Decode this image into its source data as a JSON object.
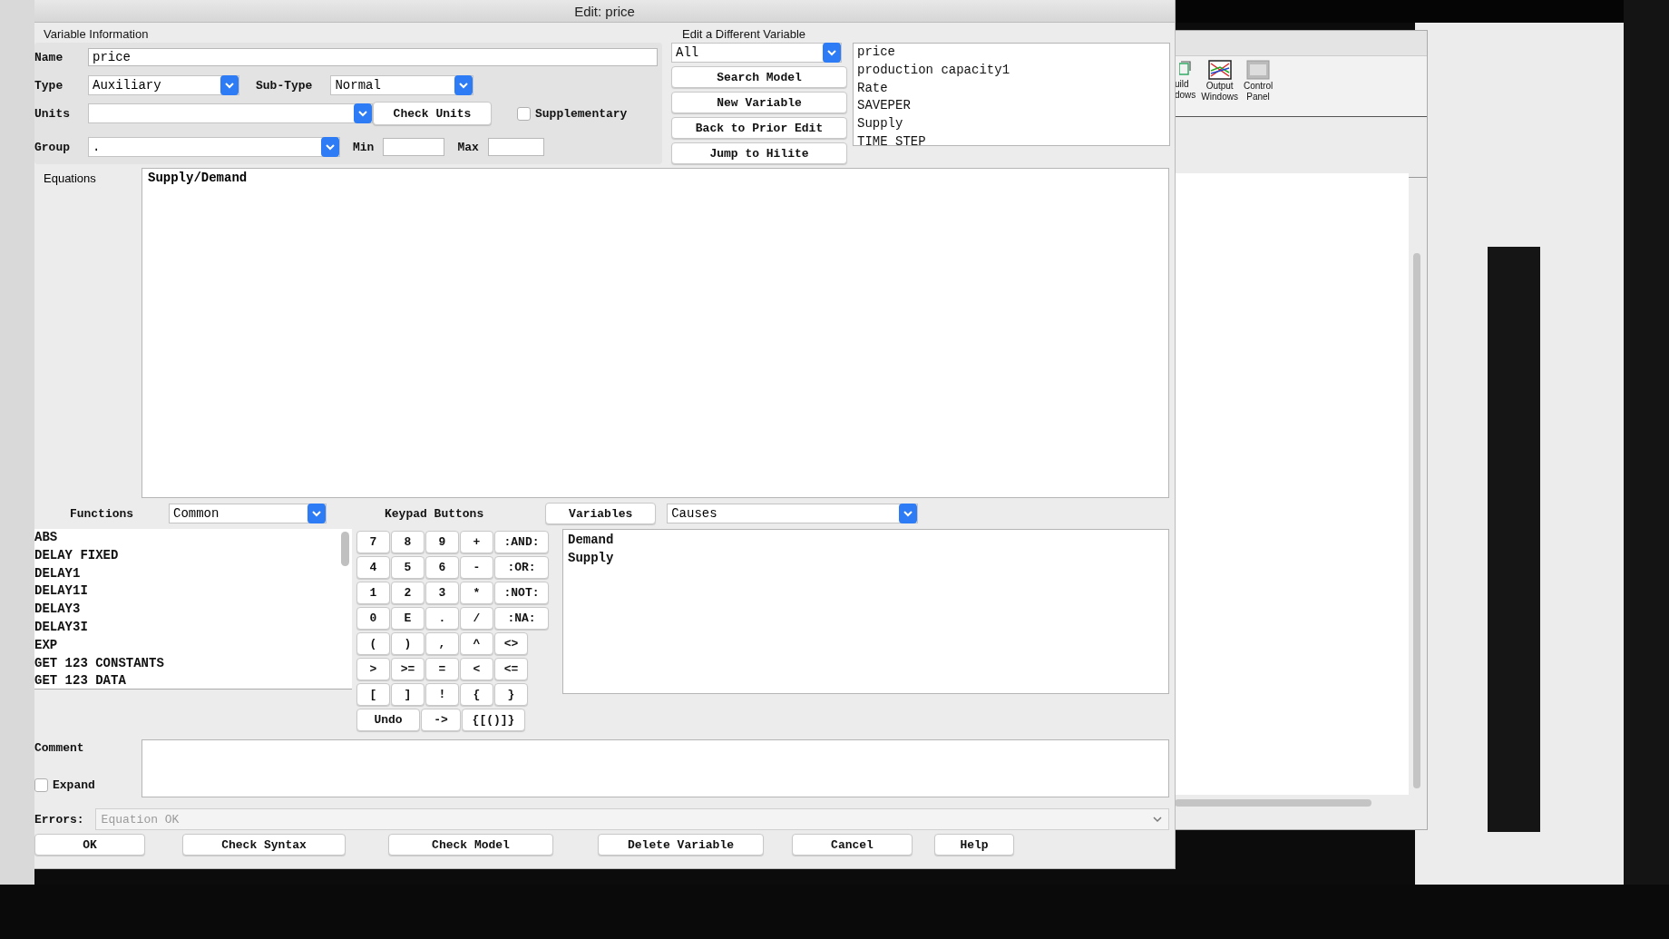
{
  "window": {
    "title": "Edit: price"
  },
  "variable_information": {
    "heading": "Variable Information",
    "name": {
      "label": "Name",
      "value": "price"
    },
    "type": {
      "label": "Type",
      "value": "Auxiliary"
    },
    "sub_type": {
      "label": "Sub-Type",
      "value": "Normal"
    },
    "units": {
      "label": "Units"
    },
    "check_units_button": "Check Units",
    "supplementary": {
      "label": "Supplementary",
      "checked": false
    },
    "group": {
      "label": "Group",
      "value": "."
    },
    "min": {
      "label": "Min"
    },
    "max": {
      "label": "Max"
    }
  },
  "edit_different_variable": {
    "heading": "Edit a Different Variable",
    "filter": "All",
    "buttons": [
      "Search Model",
      "New Variable",
      "Back to Prior Edit",
      "Jump to Hilite"
    ],
    "variables": [
      "price",
      "production capacity1",
      "Rate",
      "SAVEPER",
      "Supply",
      "TIME STEP"
    ]
  },
  "equations": {
    "label": "Equations",
    "value": "Supply/Demand"
  },
  "functions": {
    "label": "Functions",
    "category": "Common",
    "items": [
      "ABS",
      "DELAY FIXED",
      "DELAY1",
      "DELAY1I",
      "DELAY3",
      "DELAY3I",
      "EXP",
      "GET 123 CONSTANTS",
      "GET 123 DATA"
    ]
  },
  "keypad": {
    "label": "Keypad Buttons",
    "rows": [
      [
        "7",
        "8",
        "9",
        "+",
        ":AND:"
      ],
      [
        "4",
        "5",
        "6",
        "-",
        ":OR:"
      ],
      [
        "1",
        "2",
        "3",
        "*",
        ":NOT:"
      ],
      [
        "0",
        "E",
        ".",
        "/",
        ":NA:"
      ],
      [
        "(",
        ")",
        ",",
        "^",
        "<>"
      ],
      [
        ">",
        ">=",
        "=",
        "<",
        "<="
      ],
      [
        "[",
        "]",
        "!",
        "{",
        "}"
      ]
    ],
    "actions": [
      "Undo",
      "->",
      "{[()]}"
    ]
  },
  "variables_panel": {
    "tab": "Variables",
    "mode": "Causes",
    "items": [
      "Demand",
      "Supply"
    ]
  },
  "comment": {
    "label": "Comment"
  },
  "expand": {
    "label": "Expand",
    "checked": false
  },
  "errors": {
    "label": "Errors:",
    "value": "Equation OK",
    "disabled": true
  },
  "buttons": [
    "OK",
    "Check Syntax",
    "Check Model",
    "Delete Variable",
    "Cancel",
    "Help"
  ],
  "background_window": {
    "toolbar": [
      {
        "kind": "cut",
        "lines": [
          "uild",
          "dows"
        ]
      },
      {
        "kind": "output",
        "lines": [
          "Output",
          "Windows"
        ]
      },
      {
        "kind": "control",
        "lines": [
          "Control",
          "Panel"
        ]
      }
    ]
  }
}
